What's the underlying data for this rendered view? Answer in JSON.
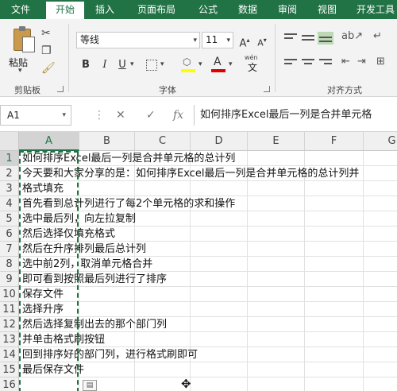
{
  "tabs": [
    "文件",
    "开始",
    "插入",
    "页面布局",
    "公式",
    "数据",
    "审阅",
    "视图",
    "开发工具"
  ],
  "ribbon": {
    "clipboard": {
      "paste_label": "粘贴",
      "group_label": "剪贴板"
    },
    "font": {
      "font_name": "等线",
      "font_size": "11",
      "grow_label": "A",
      "shrink_label": "A",
      "bold": "B",
      "italic": "I",
      "underline": "U",
      "phonetic": "wén",
      "group_label": "字体"
    },
    "alignment": {
      "group_label": "对齐方式"
    }
  },
  "formula_bar": {
    "name_box": "A1",
    "cancel_icon": "✕",
    "enter_icon": "✓",
    "fx_label": "fx",
    "content": "如何排序Excel最后一列是合并单元格"
  },
  "grid": {
    "columns": [
      "A",
      "B",
      "C",
      "D",
      "E",
      "F",
      "G"
    ],
    "rows": [
      {
        "num": "1",
        "text": "如何排序Excel最后一列是合并单元格的总计列"
      },
      {
        "num": "2",
        "text": "今天要和大家分享的是：如何排序Excel最后一列是合并单元格的总计列并"
      },
      {
        "num": "3",
        "text": "格式填充"
      },
      {
        "num": "4",
        "text": "首先看到总计列进行了每2个单元格的求和操作"
      },
      {
        "num": "5",
        "text": "选中最后列，向左拉复制"
      },
      {
        "num": "6",
        "text": "然后选择仅填充格式"
      },
      {
        "num": "7",
        "text": "然后在升序排列最后总计列"
      },
      {
        "num": "8",
        "text": "选中前2列，取消单元格合并"
      },
      {
        "num": "9",
        "text": "即可看到按照最后列进行了排序"
      },
      {
        "num": "10",
        "text": "保存文件"
      },
      {
        "num": "11",
        "text": "选择升序"
      },
      {
        "num": "12",
        "text": "然后选择复制出去的那个部门列"
      },
      {
        "num": "13",
        "text": "并单击格式刷按钮"
      },
      {
        "num": "14",
        "text": "回到排序好的部门列，进行格式刷即可"
      },
      {
        "num": "15",
        "text": "最后保存文件"
      },
      {
        "num": "16",
        "text": ""
      }
    ]
  },
  "colors": {
    "accent": "#217346"
  }
}
